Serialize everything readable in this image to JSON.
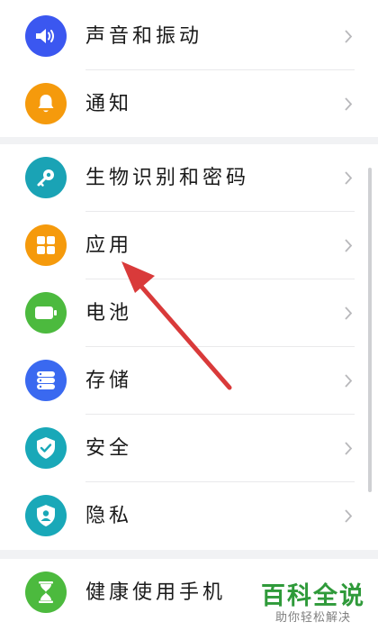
{
  "group1": {
    "items": [
      {
        "label": "声音和振动",
        "icon": "speaker-icon",
        "color": "#3b57f0"
      },
      {
        "label": "通知",
        "icon": "bell-icon",
        "color": "#f59a0c"
      }
    ]
  },
  "group2": {
    "items": [
      {
        "label": "生物识别和密码",
        "icon": "key-icon",
        "color": "#1aa3b5"
      },
      {
        "label": "应用",
        "icon": "apps-grid-icon",
        "color": "#f59a0c"
      },
      {
        "label": "电池",
        "icon": "battery-icon",
        "color": "#4cba3e"
      },
      {
        "label": "存储",
        "icon": "storage-icon",
        "color": "#3a69f0"
      },
      {
        "label": "安全",
        "icon": "shield-check-icon",
        "color": "#19a8b8"
      },
      {
        "label": "隐私",
        "icon": "privacy-shield-icon",
        "color": "#19a8b8"
      }
    ]
  },
  "group3": {
    "items": [
      {
        "label": "健康使用手机",
        "icon": "hourglass-icon",
        "color": "#4cba3e"
      }
    ]
  },
  "annotation": {
    "color": "#d93a3a"
  },
  "watermark": {
    "title": "百科全说",
    "subtitle": "助你轻松解决",
    "color": "#2f9a3a"
  }
}
